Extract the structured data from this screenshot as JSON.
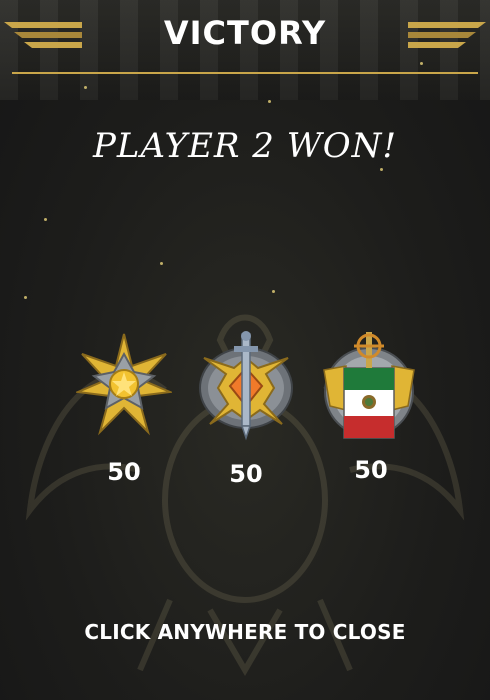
{
  "header": {
    "title": "VICTORY"
  },
  "result": {
    "winner_text": "PLAYER 2 WON!"
  },
  "rewards": [
    {
      "icon": "gold-star-medal-icon",
      "value": "50"
    },
    {
      "icon": "sword-shield-medal-icon",
      "value": "50"
    },
    {
      "icon": "mexico-flag-medal-icon",
      "value": "50"
    }
  ],
  "footer": {
    "close_hint": "CLICK ANYWHERE TO CLOSE"
  },
  "colors": {
    "accent_gold": "#c9a64a",
    "text": "#ffffff",
    "background": "#1c1c1c"
  }
}
